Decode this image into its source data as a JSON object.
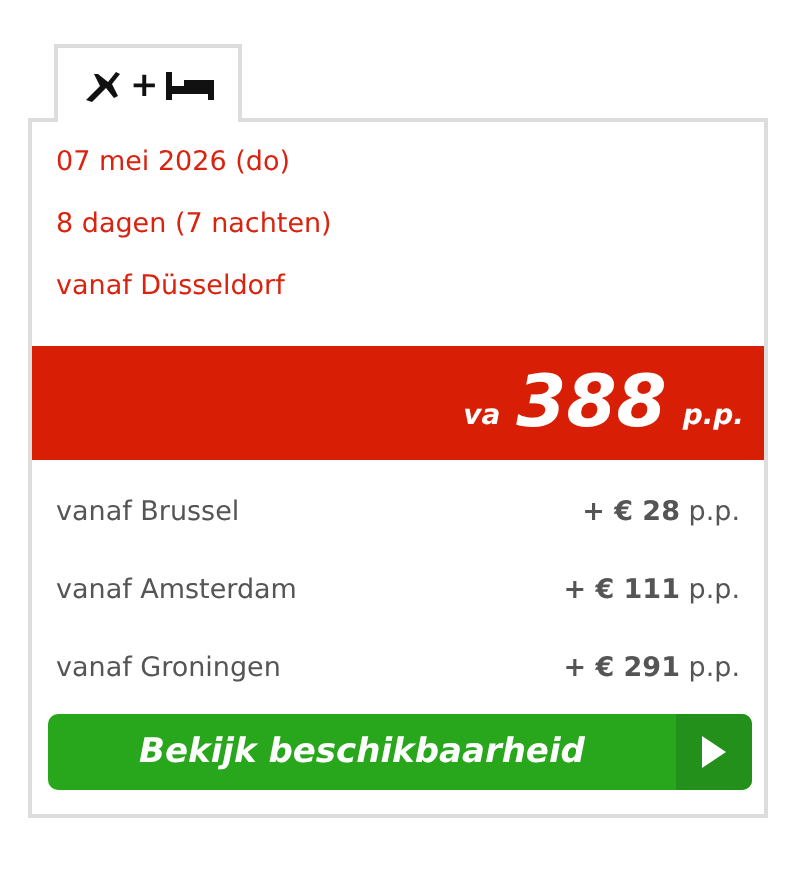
{
  "tabs": [
    {
      "kind": "flight-hotel",
      "plus": "+",
      "selected": true
    }
  ],
  "details": [
    "07 mei 2026 (do)",
    "8 dagen (7 nachten)",
    "vanaf Düsseldorf"
  ],
  "price": {
    "prefix": "va",
    "amount": "388",
    "suffix": "p.p."
  },
  "alternatives": [
    {
      "label": "vanaf Brussel",
      "surcharge": "**+ € 28** p.p."
    },
    {
      "label": "vanaf Amsterdam",
      "surcharge": "**+ € 111** p.p."
    },
    {
      "label": "vanaf Groningen",
      "surcharge": "**+ € 291** p.p."
    }
  ],
  "button": {
    "label": "Bekijk beschikbaarheid"
  }
}
